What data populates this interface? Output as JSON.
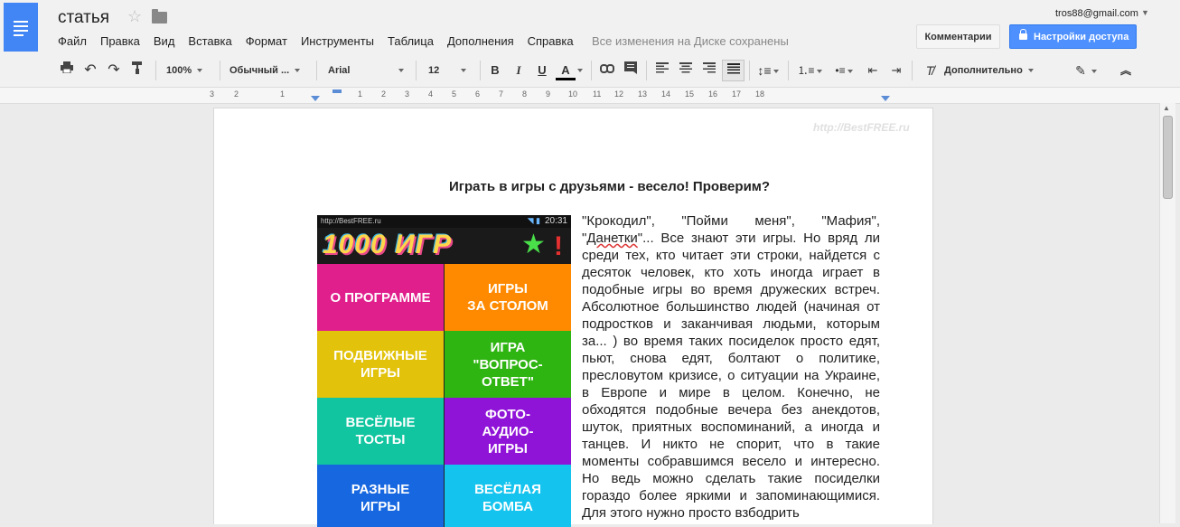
{
  "app": {
    "doc_title": "статья",
    "save_status": "Все изменения на Диске сохранены",
    "user_email": "tros88@gmail.com"
  },
  "menu": {
    "items": [
      "Файл",
      "Правка",
      "Вид",
      "Вставка",
      "Формат",
      "Инструменты",
      "Таблица",
      "Дополнения",
      "Справка"
    ]
  },
  "buttons": {
    "comments": "Комментарии",
    "share": "Настройки доступа"
  },
  "toolbar": {
    "zoom": "100%",
    "style": "Обычный ...",
    "font": "Arial",
    "size": "12",
    "bold": "B",
    "italic": "I",
    "underline": "U",
    "text_color": "A",
    "more": "Дополнительно",
    "text_color_value": "#000000"
  },
  "ruler": {
    "labels": [
      "3",
      "2",
      "1",
      "1",
      "2",
      "3",
      "4",
      "5",
      "6",
      "7",
      "8",
      "9",
      "10",
      "11",
      "12",
      "13",
      "14",
      "15",
      "16",
      "17",
      "18"
    ]
  },
  "document": {
    "watermark": "http://BestFREE.ru",
    "heading": "Играть в игры с друзьями - весело! Проверим?",
    "body_parts": [
      "\"Крокодил\", \"Пойми меня\", \"Мафия\", \"",
      "Данетки",
      "\"... Все знают эти игры. Но вряд ли среди тех, кто читает эти строки, найдется с десяток человек, кто хоть иногда играет в подобные игры во время дружеских встреч. Абсолютное большинство людей (начиная от подростков и заканчивая людьми, которым за... ) во время таких посиделок просто едят, пьют, снова едят, болтают о политике, пресловутом кризисе, о ситуации на Украине, в Европе и мире в целом. Конечно, не обходятся подобные вечера без анекдотов, шуток, приятных воспоминаний, а иногда и танцев. И никто не спорит, что в такие моменты собравшимся весело и интересно. Но ведь можно сделать такие посиделки гораздо более яркими и запоминающимися. Для этого нужно просто взбодрить"
    ]
  },
  "app_image": {
    "status_url": "http://BestFREE.ru",
    "status_time": "20:31",
    "logo_text": "1000 ИГР",
    "logo_star": "★",
    "logo_excl": "!",
    "tiles": [
      {
        "label": "О ПРОГРАММЕ",
        "color": "#e01e8c"
      },
      {
        "label": "ИГРЫ\nЗА СТОЛОМ",
        "color": "#ff8a00"
      },
      {
        "label": "ПОДВИЖНЫЕ\nИГРЫ",
        "color": "#e2c20a"
      },
      {
        "label": "ИГРА\n\"ВОПРОС-\nОТВЕТ\"",
        "color": "#2fb512"
      },
      {
        "label": "ВЕСЁЛЫЕ\nТОСТЫ",
        "color": "#10c5a0"
      },
      {
        "label": "ФОТО-\nАУДИО-\nИГРЫ",
        "color": "#9013d8"
      },
      {
        "label": "РАЗНЫЕ\nИГРЫ",
        "color": "#1767e0"
      },
      {
        "label": "ВЕСЁЛАЯ\nБОМБА",
        "color": "#14c3ee"
      }
    ]
  }
}
